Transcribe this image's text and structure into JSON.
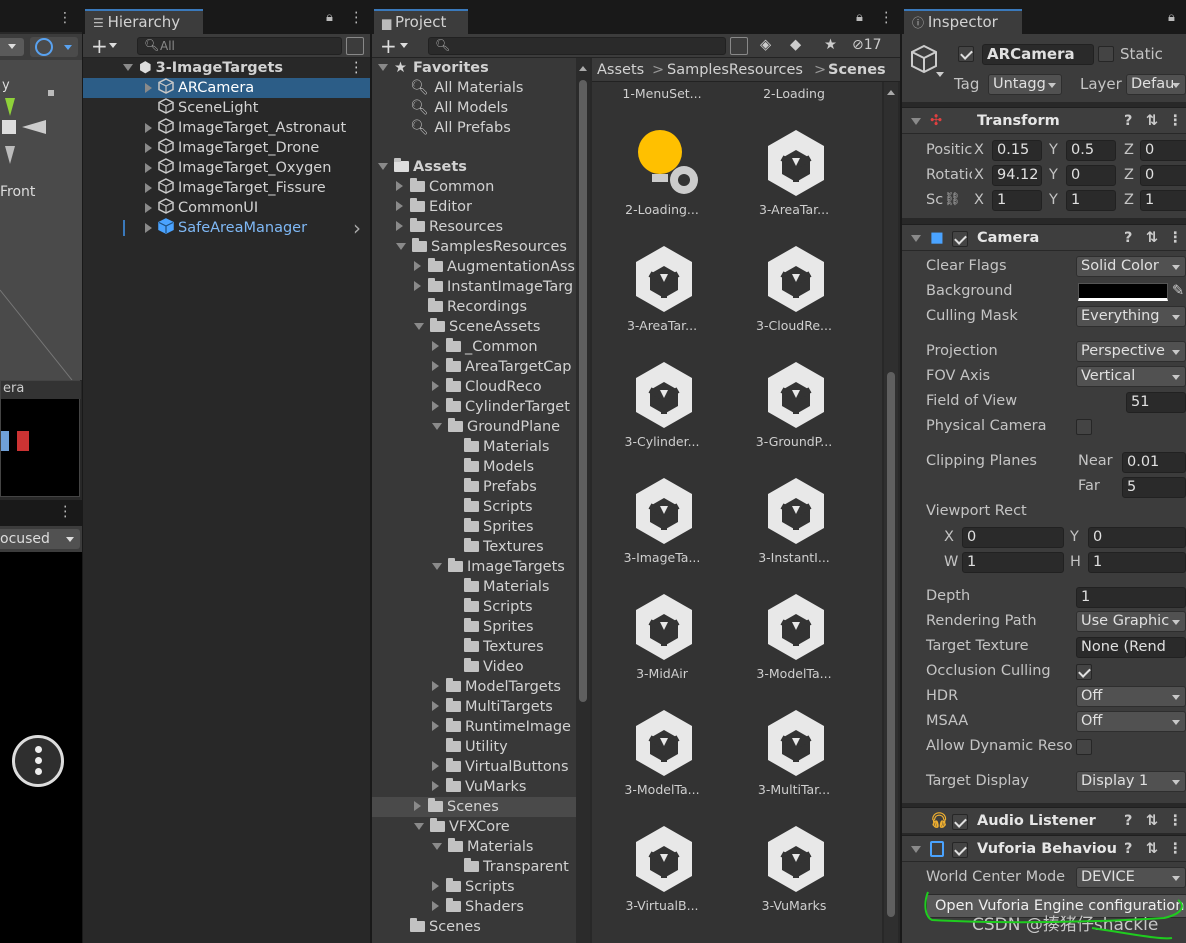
{
  "scene_view": {
    "axis_y_label": "y",
    "view_label": "Front",
    "camera_preview_title": "era",
    "game_dropdown": "ocused"
  },
  "hierarchy": {
    "tab_title": "Hierarchy",
    "search_placeholder": "All",
    "root": "3-ImageTargets",
    "items": [
      {
        "label": "ARCamera",
        "selected": true
      },
      {
        "label": "SceneLight"
      },
      {
        "label": "ImageTarget_Astronaut"
      },
      {
        "label": "ImageTarget_Drone"
      },
      {
        "label": "ImageTarget_Oxygen"
      },
      {
        "label": "ImageTarget_Fissure"
      },
      {
        "label": "CommonUI"
      },
      {
        "label": "SafeAreaManager",
        "prefab": true
      }
    ]
  },
  "project": {
    "tab_title": "Project",
    "hidden_count": "17",
    "breadcrumb": [
      "Assets",
      "SamplesResources",
      "Scenes"
    ],
    "favorites_title": "Favorites",
    "favorites": [
      "All Materials",
      "All Models",
      "All Prefabs"
    ],
    "assets_title": "Assets",
    "tree": [
      {
        "label": "Common",
        "d": 1
      },
      {
        "label": "Editor",
        "d": 1
      },
      {
        "label": "Resources",
        "d": 1
      },
      {
        "label": "SamplesResources",
        "d": 1
      },
      {
        "label": "AugmentationAss",
        "d": 2
      },
      {
        "label": "InstantImageTarg",
        "d": 2
      },
      {
        "label": "Recordings",
        "d": 2
      },
      {
        "label": "SceneAssets",
        "d": 2
      },
      {
        "label": "_Common",
        "d": 3
      },
      {
        "label": "AreaTargetCap",
        "d": 3
      },
      {
        "label": "CloudReco",
        "d": 3
      },
      {
        "label": "CylinderTarget",
        "d": 3
      },
      {
        "label": "GroundPlane",
        "d": 3
      },
      {
        "label": "Materials",
        "d": 4
      },
      {
        "label": "Models",
        "d": 4
      },
      {
        "label": "Prefabs",
        "d": 4
      },
      {
        "label": "Scripts",
        "d": 4
      },
      {
        "label": "Sprites",
        "d": 4
      },
      {
        "label": "Textures",
        "d": 4
      },
      {
        "label": "ImageTargets",
        "d": 3
      },
      {
        "label": "Materials",
        "d": 4
      },
      {
        "label": "Scripts",
        "d": 4
      },
      {
        "label": "Sprites",
        "d": 4
      },
      {
        "label": "Textures",
        "d": 4
      },
      {
        "label": "Video",
        "d": 4
      },
      {
        "label": "ModelTargets",
        "d": 3
      },
      {
        "label": "MultiTargets",
        "d": 3
      },
      {
        "label": "RuntimeImage",
        "d": 3
      },
      {
        "label": "Utility",
        "d": 3
      },
      {
        "label": "VirtualButtons",
        "d": 3
      },
      {
        "label": "VuMarks",
        "d": 3
      },
      {
        "label": "Scenes",
        "d": 2
      },
      {
        "label": "VFXCore",
        "d": 2
      },
      {
        "label": "Materials",
        "d": 3
      },
      {
        "label": "Transparent",
        "d": 4
      },
      {
        "label": "Scripts",
        "d": 3
      },
      {
        "label": "Shaders",
        "d": 3
      },
      {
        "label": "Scenes",
        "d": 1
      }
    ],
    "grid": [
      "1-MenuSet...",
      "2-Loading",
      "2-Loading...",
      "3-AreaTar...",
      "3-AreaTar...",
      "3-CloudRe...",
      "3-Cylinder...",
      "3-GroundP...",
      "3-ImageTa...",
      "3-InstantI...",
      "3-MidAir",
      "3-ModelTa...",
      "3-ModelTa...",
      "3-MultiTar...",
      "3-VirtualB...",
      "3-VuMarks"
    ]
  },
  "inspector": {
    "tab_title": "Inspector",
    "object_name": "ARCamera",
    "static_label": "Static",
    "tag_label": "Tag",
    "tag_value": "Untagg",
    "layer_label": "Layer",
    "layer_value": "Defau",
    "transform": {
      "title": "Transform",
      "position_label": "Positic",
      "rotation_label": "Rotatic",
      "scale_label": "Sc",
      "px": "0.15",
      "py": "0.5",
      "pz": "0",
      "rx": "94.12",
      "ry": "0",
      "rz": "0",
      "sx": "1",
      "sy": "1",
      "sz": "1"
    },
    "camera": {
      "title": "Camera",
      "clear_flags_label": "Clear Flags",
      "clear_flags": "Solid Color",
      "background_label": "Background",
      "culling_mask_label": "Culling Mask",
      "culling_mask": "Everything",
      "projection_label": "Projection",
      "projection": "Perspective",
      "fov_axis_label": "FOV Axis",
      "fov_axis": "Vertical",
      "fov_label": "Field of View",
      "fov": "51",
      "physical_label": "Physical Camera",
      "clipping_label": "Clipping Planes",
      "near_label": "Near",
      "near": "0.01",
      "far_label": "Far",
      "far": "5",
      "viewport_label": "Viewport Rect",
      "vx": "0",
      "vy": "0",
      "vw": "1",
      "vh": "1",
      "depth_label": "Depth",
      "depth": "1",
      "rendering_path_label": "Rendering Path",
      "rendering_path": "Use Graphic",
      "target_texture_label": "Target Texture",
      "target_texture": "None (Rend",
      "occlusion_label": "Occlusion Culling",
      "hdr_label": "HDR",
      "hdr": "Off",
      "msaa_label": "MSAA",
      "msaa": "Off",
      "dynres_label": "Allow Dynamic Reso",
      "target_display_label": "Target Display",
      "target_display": "Display 1"
    },
    "audio_listener": "Audio Listener",
    "vuforia": {
      "title": "Vuforia Behaviour (",
      "world_center_label": "World Center Mode",
      "world_center": "DEVICE",
      "open_config": "Open Vuforia Engine configuration"
    },
    "watermark": "CSDN @揍猪仔shackle"
  },
  "colors": {
    "selection": "#2c5d87",
    "accent": "#3a79bb",
    "annotation": "#1fcc1f"
  }
}
